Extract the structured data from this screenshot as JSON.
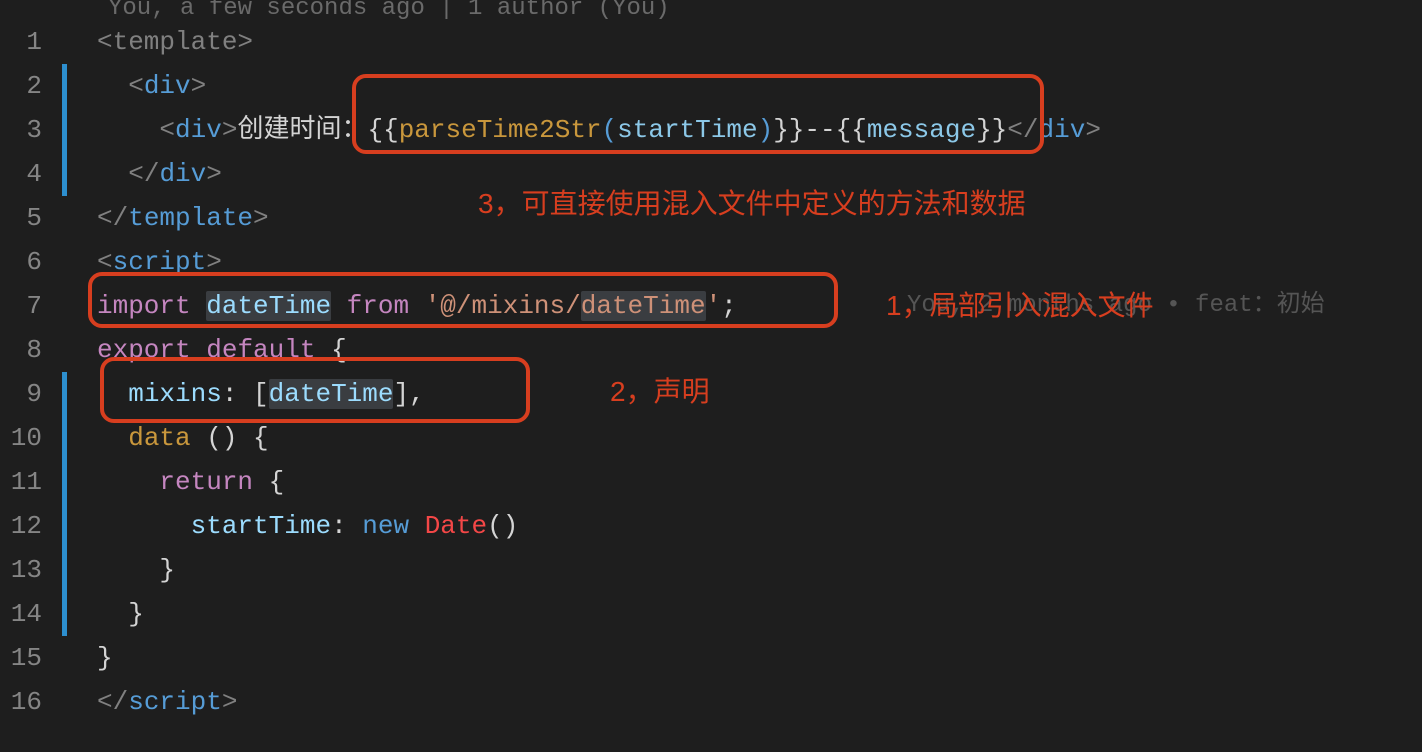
{
  "blame": "You, a few seconds ago | 1 author (You)",
  "lines": {
    "l1": {
      "n": "1"
    },
    "l2": {
      "n": "2"
    },
    "l3": {
      "n": "3",
      "text_cn": "创建时间："
    },
    "l4": {
      "n": "4"
    },
    "l5": {
      "n": "5"
    },
    "l6": {
      "n": "6"
    },
    "l7": {
      "n": "7",
      "import_kw": "import",
      "name": "dateTime",
      "from_kw": "from",
      "path": "'@/mixins/dateTime'"
    },
    "l8": {
      "n": "8",
      "export_kw": "export",
      "default_kw": "default"
    },
    "l9": {
      "n": "9",
      "mixins": "mixins",
      "val": "dateTime"
    },
    "l10": {
      "n": "10",
      "data": "data"
    },
    "l11": {
      "n": "11",
      "return": "return"
    },
    "l12": {
      "n": "12",
      "prop": "startTime",
      "new": "new",
      "date": "Date"
    },
    "l13": {
      "n": "13"
    },
    "l14": {
      "n": "14"
    },
    "l15": {
      "n": "15"
    },
    "l16": {
      "n": "16"
    }
  },
  "tags": {
    "template_open": "<template>",
    "template_close": "</template>",
    "div_open": "<div>",
    "div_close": "</div>",
    "script_open": "<script>",
    "script_close": "</script>"
  },
  "expr": {
    "open": "{{",
    "close": "}}",
    "fn": "parseTime2Str",
    "arg": "startTime",
    "sep": "--",
    "msg": "message"
  },
  "inline_blame": "You, 2 months ago • feat：初始",
  "annotations": {
    "a1": "1，局部引入混入文件",
    "a2": "2，声明",
    "a3": "3，可直接使用混入文件中定义的方法和数据"
  }
}
